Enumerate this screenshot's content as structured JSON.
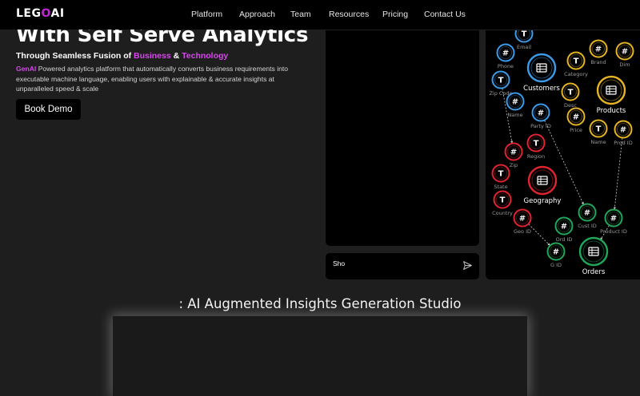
{
  "nav": {
    "logo_prefix": "LEG",
    "logo_o": "O",
    "logo_suffix": "AI",
    "links": [
      "Platform",
      "Approach",
      "Team",
      "Resources",
      "Pricing",
      "Contact Us"
    ]
  },
  "hero": {
    "title": "With Self Serve Analytics",
    "subtitle_pre": "Through Seamless Fusion of ",
    "subtitle_business": "Business",
    "subtitle_amp": " & ",
    "subtitle_technology": "Technology",
    "desc_highlight": "GenAI",
    "desc_text": " Powered analytics platform that automatically converts business requirements into executable machine language, enabling users with explainable & accurate insights at unparalleled speed & scale",
    "cta": "Book Demo"
  },
  "chat": {
    "input_value": "Sho"
  },
  "graph": {
    "colors": {
      "blue": "#3b9be8",
      "yellow": "#e6b422",
      "red": "#e0232e",
      "green": "#1fa85a"
    },
    "entities": [
      {
        "id": "customers",
        "label": "Customers",
        "color": "blue"
      },
      {
        "id": "products",
        "label": "Products",
        "color": "yellow"
      },
      {
        "id": "geography",
        "label": "Geography",
        "color": "red"
      },
      {
        "id": "orders",
        "label": "Orders",
        "color": "green"
      }
    ],
    "attributes": [
      {
        "id": "email",
        "label": "Email",
        "type": "T",
        "color": "blue"
      },
      {
        "id": "phone",
        "label": "Phone",
        "type": "#",
        "color": "blue"
      },
      {
        "id": "zipcode",
        "label": "Zip Code",
        "type": "T",
        "color": "blue"
      },
      {
        "id": "cname",
        "label": "Name",
        "type": "#",
        "color": "blue"
      },
      {
        "id": "partyid",
        "label": "Party ID",
        "type": "#",
        "color": "blue"
      },
      {
        "id": "brand",
        "label": "Brand",
        "type": "#",
        "color": "yellow"
      },
      {
        "id": "category",
        "label": "Category",
        "type": "T",
        "color": "yellow"
      },
      {
        "id": "dim",
        "label": "Dim",
        "type": "#",
        "color": "yellow"
      },
      {
        "id": "desc",
        "label": "Desc",
        "type": "T",
        "color": "yellow"
      },
      {
        "id": "price",
        "label": "Price",
        "type": "#",
        "color": "yellow"
      },
      {
        "id": "pname",
        "label": "Name",
        "type": "T",
        "color": "yellow"
      },
      {
        "id": "prodid",
        "label": "Prod ID",
        "type": "#",
        "color": "yellow"
      },
      {
        "id": "zip",
        "label": "Zip",
        "type": "#",
        "color": "red"
      },
      {
        "id": "region",
        "label": "Region",
        "type": "T",
        "color": "red"
      },
      {
        "id": "state",
        "label": "State",
        "type": "T",
        "color": "red"
      },
      {
        "id": "country",
        "label": "Country",
        "type": "T",
        "color": "red"
      },
      {
        "id": "geoid",
        "label": "Geo ID",
        "type": "#",
        "color": "red"
      },
      {
        "id": "custid",
        "label": "Cust ID",
        "type": "#",
        "color": "green"
      },
      {
        "id": "ordid",
        "label": "Ord ID",
        "type": "#",
        "color": "green"
      },
      {
        "id": "productid",
        "label": "Product ID",
        "type": "#",
        "color": "green"
      },
      {
        "id": "gid",
        "label": "G ID",
        "type": "#",
        "color": "green"
      }
    ]
  },
  "studio": {
    "title": ": AI Augmented Insights Generation Studio"
  }
}
